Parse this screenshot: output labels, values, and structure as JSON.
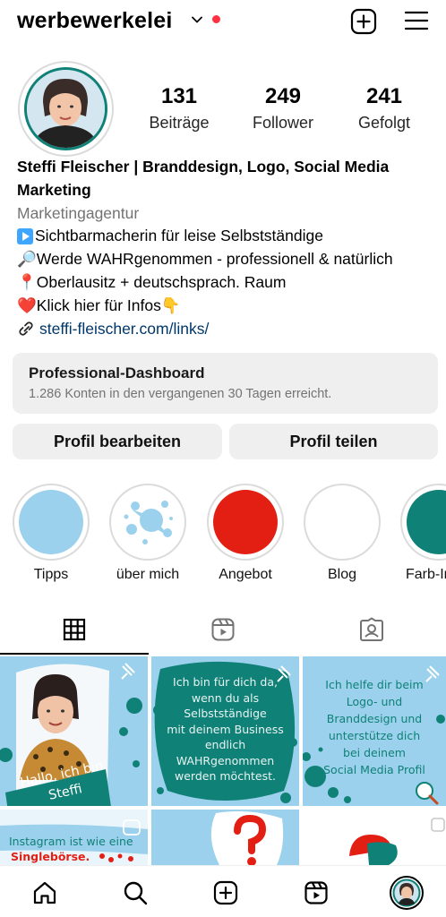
{
  "header": {
    "username": "werbewerkelei"
  },
  "stats": [
    {
      "count": "131",
      "label": "Beiträge"
    },
    {
      "count": "249",
      "label": "Follower"
    },
    {
      "count": "241",
      "label": "Gefolgt"
    }
  ],
  "bio": {
    "name_line1": "Steffi Fleischer | Branddesign, Logo, Social Media",
    "name_line2": "Marketing",
    "category": "Marketingagentur",
    "lines": [
      "Sichtbarmacherin für leise Selbstständige",
      "🔎Werde WAHRgenommen - professionell & natürlich",
      "📍Oberlausitz + deutschsprach. Raum",
      "❤️Klick hier für Infos👇"
    ],
    "link": "steffi-fleischer.com/links/"
  },
  "dashboard": {
    "title": "Professional-Dashboard",
    "subtitle": "1.286 Konten in den vergangenen 30 Tagen erreicht."
  },
  "buttons": {
    "edit": "Profil bearbeiten",
    "share": "Profil teilen"
  },
  "highlights": [
    {
      "label": "Tipps",
      "color": "#9bd1ec"
    },
    {
      "label": "über mich",
      "color": "#ffffff"
    },
    {
      "label": "Angebot",
      "color": "#e31f14"
    },
    {
      "label": "Blog",
      "color": "#ffffff"
    },
    {
      "label": "Farb-In",
      "color": "#0f8177"
    }
  ],
  "posts": {
    "p1": {
      "line1": "Hallo, ich bin",
      "line2": "Steffi"
    },
    "p2": [
      "Ich bin für dich da,",
      "wenn du als",
      "Selbstständige",
      "mit deinem Business",
      "endlich",
      "WAHRgenommen",
      "werden möchtest."
    ],
    "p3": [
      "Ich helfe dir beim",
      "Logo- und",
      "Branddesign und",
      "unterstütze dich",
      "bei deinem",
      "Social Media Profil"
    ],
    "p4": {
      "line1": "Instagram ist wie eine",
      "line2": "Singlebörse."
    }
  },
  "colors": {
    "teal": "#0f8177",
    "light_blue": "#9bd1ec",
    "red": "#e31f14",
    "link": "#00376b"
  }
}
